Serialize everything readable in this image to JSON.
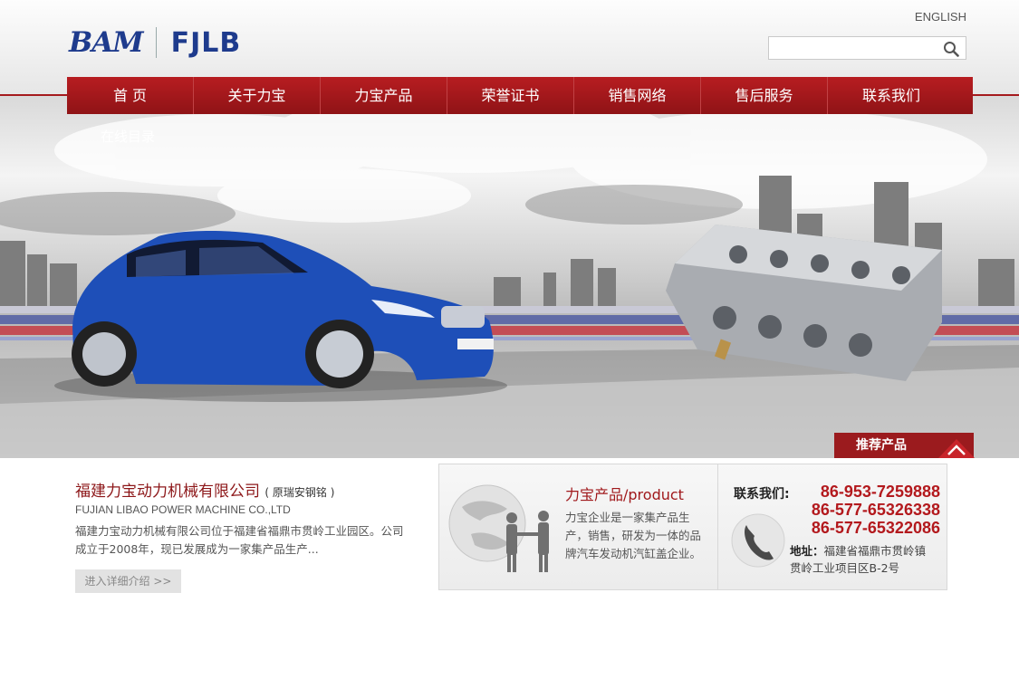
{
  "header": {
    "logo_left": "BAM",
    "logo_right": "FJLB",
    "language_link": "ENGLISH",
    "search": {
      "value": "",
      "placeholder": ""
    }
  },
  "nav": {
    "items": [
      {
        "label": "首 页"
      },
      {
        "label": "关于力宝"
      },
      {
        "label": "力宝产品"
      },
      {
        "label": "荣誉证书"
      },
      {
        "label": "销售网络"
      },
      {
        "label": "售后服务"
      },
      {
        "label": "联系我们"
      }
    ],
    "sub_item": "在线目录"
  },
  "banner": {
    "recommend_tab": "推荐产品"
  },
  "company": {
    "name": "福建力宝动力机械有限公司",
    "former_name": "( 原瑞安钢铭 )",
    "name_en": "FUJIAN LIBAO POWER MACHINE CO.,LTD",
    "description": "福建力宝动力机械有限公司位于福建省福鼎市贯岭工业园区。公司成立于2008年，现已发展成为一家集产品生产...",
    "more_button": "进入详细介绍 >>"
  },
  "products": {
    "title": "力宝产品/product",
    "description": "力宝企业是一家集产品生产，销售，研发为一体的品牌汽车发动机汽缸盖企业。"
  },
  "contact": {
    "title": "联系我们:",
    "phones": [
      "86-953-7259888",
      "86-577-65326338",
      "86-577-65322086"
    ],
    "address_label": "地址：",
    "address": "福建省福鼎市贯岭镇贯岭工业项目区B-2号"
  },
  "colors": {
    "brand_red": "#a51a1d",
    "brand_blue": "#1e3b8d",
    "nav_bg": "#a3181c"
  }
}
